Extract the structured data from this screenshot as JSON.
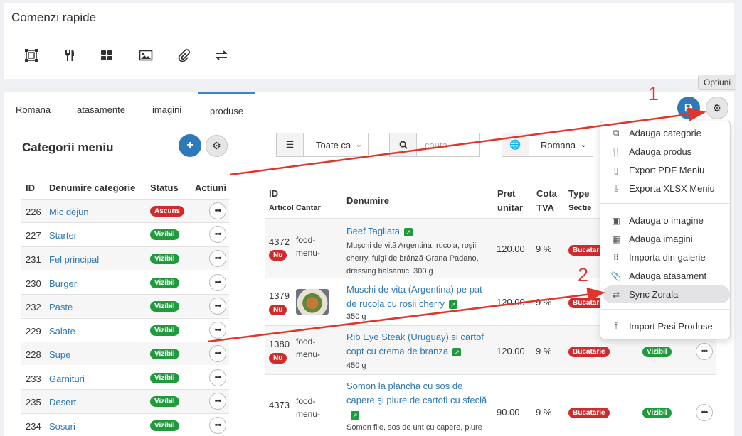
{
  "quick_commands": {
    "title": "Comenzi rapide",
    "icons": [
      "category-add-icon",
      "cutlery-icon",
      "grid-icon",
      "image-icon",
      "paperclip-icon",
      "sync-icon"
    ]
  },
  "tabs": [
    "Romana",
    "atasamente",
    "imagini",
    "produse"
  ],
  "active_tab": "produse",
  "tooltip": "Optiuni",
  "categories": {
    "title": "Categorii meniu",
    "headers": [
      "ID",
      "Denumire categorie",
      "Status",
      "Actiuni"
    ],
    "rows": [
      {
        "id": "226",
        "name": "Mic dejun",
        "status": "Ascuns"
      },
      {
        "id": "227",
        "name": "Starter",
        "status": "Vizibil"
      },
      {
        "id": "231",
        "name": "Fel principal",
        "status": "Vizibil"
      },
      {
        "id": "230",
        "name": "Burgeri",
        "status": "Vizibil"
      },
      {
        "id": "232",
        "name": "Paste",
        "status": "Vizibil"
      },
      {
        "id": "229",
        "name": "Salate",
        "status": "Vizibil"
      },
      {
        "id": "228",
        "name": "Supe",
        "status": "Vizibil"
      },
      {
        "id": "233",
        "name": "Garnituri",
        "status": "Vizibil"
      },
      {
        "id": "235",
        "name": "Desert",
        "status": "Vizibil"
      },
      {
        "id": "234",
        "name": "Sosuri",
        "status": "Vizibil"
      }
    ]
  },
  "toolbar": {
    "category_select": "Toate ca",
    "search_placeholder": "cauta",
    "language_select": "Romana"
  },
  "products": {
    "headers": {
      "id": "ID",
      "id_sub": "Articol Cantar",
      "name": "Denumire",
      "price": "Pret unitar",
      "price_line1": "Pret",
      "price_line2": "unitar",
      "vat_line1": "Cota",
      "vat_line2": "TVA",
      "type": "Type",
      "type_sub": "Sectie"
    },
    "rows": [
      {
        "id": "4372",
        "badge": "Nu",
        "img": "food-menu-",
        "name": "Beef Tagliata",
        "desc": "Muşchi de vită Argentina, rucola, roşii cherry, fulgi de brânză Grana Padano, dressing balsamic. 300 g",
        "price": "120.00",
        "vat": "9 %",
        "section": "Bucatarie",
        "status": ""
      },
      {
        "id": "1379",
        "badge": "Nu",
        "img": "",
        "name": "Muschi de vita (Argentina) pe pat de rucola cu rosii cherry",
        "desc": "350 g",
        "price": "120.00",
        "vat": "9 %",
        "section": "Bucatarie",
        "status": ""
      },
      {
        "id": "1380",
        "badge": "Nu",
        "img": "food-menu-",
        "name": "Rib Eye Steak (Uruguay) si cartof copt cu crema de branza",
        "desc": "450 g",
        "price": "120.00",
        "vat": "9 %",
        "section": "Bucatarie",
        "status": "Vizibil"
      },
      {
        "id": "4373",
        "badge": "Nu",
        "img": "food-menu-",
        "name": "Somon la plancha cu sos de capere şi piure de cartofi cu sfeclă",
        "desc": "Somon file, sos de unt cu capere, piure",
        "price": "90.00",
        "vat": "9 %",
        "section": "Bucatarie",
        "status": "Vizibil"
      }
    ]
  },
  "options_menu": {
    "items": [
      {
        "label": "Adauga categorie",
        "icon": "category-add-icon"
      },
      {
        "label": "Adauga produs",
        "icon": "cutlery-icon"
      },
      {
        "label": "Export PDF Meniu",
        "icon": "pdf-icon"
      },
      {
        "label": "Exporta XLSX Meniu",
        "icon": "export-icon"
      },
      {
        "label": "Adauga o imagine",
        "icon": "image-icon"
      },
      {
        "label": "Adauga imagini",
        "icon": "grid-icon"
      },
      {
        "label": "Importa din galerie",
        "icon": "gallery-icon"
      },
      {
        "label": "Adauga atasament",
        "icon": "paperclip-icon"
      },
      {
        "label": "Sync Zorala",
        "icon": "sync-icon"
      },
      {
        "label": "Import Pasi Produse",
        "icon": "import-icon"
      }
    ],
    "highlighted": "Sync Zorala"
  },
  "annotations": [
    "1",
    "2"
  ],
  "colors": {
    "accent": "#2e7ab8",
    "danger": "#d02a2a",
    "success": "#1f9b3c",
    "annotation": "#e0352b"
  }
}
